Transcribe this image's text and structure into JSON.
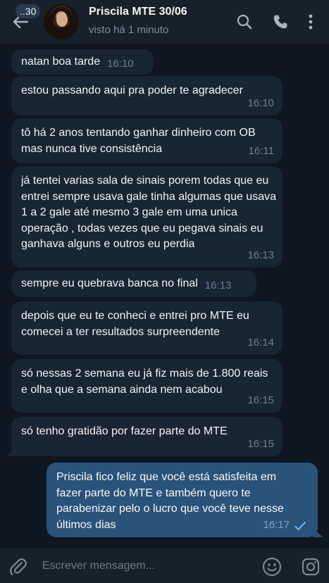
{
  "header": {
    "unread_count": "..30",
    "title": "Priscila MTE 30/06",
    "status": "visto há 1 minuto",
    "icons": [
      "back-arrow-icon",
      "search-icon",
      "phone-icon",
      "more-vertical-icon"
    ]
  },
  "messages": [
    {
      "direction": "in",
      "text": "natan boa tarde",
      "time": "16:10"
    },
    {
      "direction": "in",
      "text": "estou passando aqui pra poder te agradecer",
      "time": "16:10"
    },
    {
      "direction": "in",
      "text": "tô há 2 anos tentando ganhar dinheiro com OB mas nunca tive consistência",
      "time": "16:11"
    },
    {
      "direction": "in",
      "text": "já tentei varias sala de sinais porem todas que eu entrei sempre usava gale tinha algumas que usava 1 a 2 gale até mesmo 3 gale em uma unica operação , todas vezes que eu pegava sinais eu ganhava alguns e outros eu perdia",
      "time": "16:13"
    },
    {
      "direction": "in",
      "text": "sempre eu quebrava banca no final",
      "time": "16:13"
    },
    {
      "direction": "in",
      "text": "depois que eu te conheci e entrei pro MTE eu comecei a ter resultados surpreendente",
      "time": "16:14"
    },
    {
      "direction": "in",
      "text": "só nessas 2 semana eu já fiz mais de 1.800 reais  e olha que a semana ainda nem acabou",
      "time": "16:15"
    },
    {
      "direction": "in",
      "text": "só tenho gratidão por fazer parte do MTE",
      "time": "16:15"
    },
    {
      "direction": "out",
      "text": "Priscila fico feliz que você está satisfeita  em fazer parte do MTE e também quero te parabenizar pelo o lucro que você teve nesse últimos dias",
      "time": "16:17",
      "status": "read"
    }
  ],
  "composer": {
    "placeholder": "Escrever mensagem...",
    "icons": [
      "paperclip-icon",
      "emoji-icon",
      "camera-icon"
    ]
  },
  "colors": {
    "background": "#0e1621",
    "header": "#17212b",
    "incoming_bubble": "#182533",
    "outgoing_bubble": "#2b5278",
    "timestamp": "#6d7f8f",
    "read_check": "#6ab3f3"
  }
}
